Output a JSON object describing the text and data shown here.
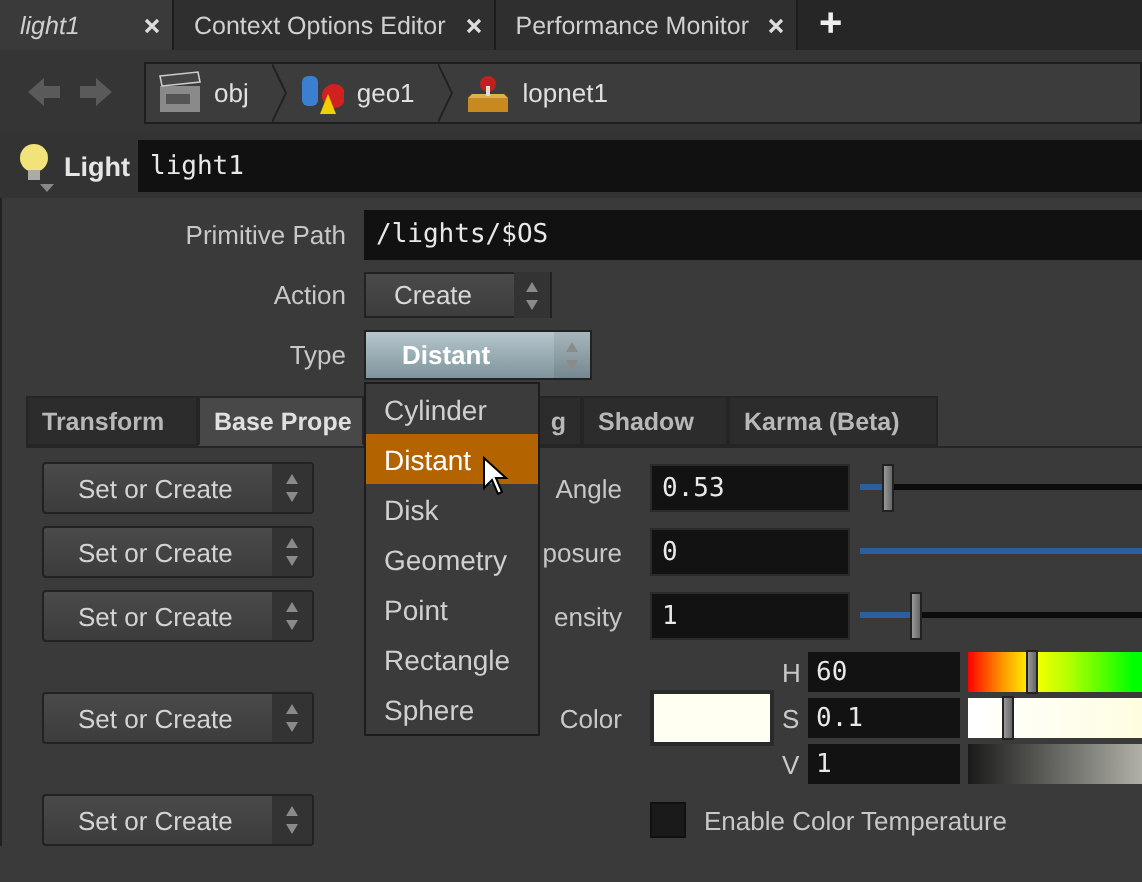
{
  "tabs": [
    {
      "label": "light1",
      "selected": true
    },
    {
      "label": "Context Options Editor",
      "selected": false
    },
    {
      "label": "Performance Monitor",
      "selected": false
    }
  ],
  "add_tab": "+",
  "path": [
    {
      "label": "obj",
      "kind": "clapper"
    },
    {
      "label": "geo1",
      "kind": "shapes"
    },
    {
      "label": "lopnet1",
      "kind": "crate"
    }
  ],
  "node": {
    "type": "Light",
    "name": "light1"
  },
  "fields": {
    "primitive_path": {
      "label": "Primitive Path",
      "value": "/lights/$OS"
    },
    "action": {
      "label": "Action",
      "value": "Create"
    },
    "type": {
      "label": "Type",
      "value": "Distant"
    }
  },
  "type_menu": [
    {
      "label": "Cylinder",
      "selected": false
    },
    {
      "label": "Distant",
      "selected": true
    },
    {
      "label": "Disk",
      "selected": false
    },
    {
      "label": "Geometry",
      "selected": false
    },
    {
      "label": "Point",
      "selected": false
    },
    {
      "label": "Rectangle",
      "selected": false
    },
    {
      "label": "Sphere",
      "selected": false
    }
  ],
  "param_tabs": [
    {
      "label": "Transform",
      "selected": false
    },
    {
      "label": "Base Prope",
      "selected": true
    },
    {
      "label": "g",
      "selected": false
    },
    {
      "label": "Shadow",
      "selected": false
    },
    {
      "label": "Karma (Beta)",
      "selected": false
    }
  ],
  "params": [
    {
      "kind": "slider",
      "control": "Set or Create",
      "label": "Angle",
      "value": "0.53",
      "level": 0.1
    },
    {
      "kind": "slider",
      "control": "Set or Create",
      "label": "posure",
      "value": "0",
      "level": 1
    },
    {
      "kind": "slider",
      "control": "Set or Create",
      "label": "ensity",
      "value": "1",
      "level": 0.2
    },
    {
      "kind": "color",
      "control": "Set or Create",
      "label": "Color",
      "color": "#fffff2",
      "channels": [
        {
          "kind": "hue",
          "label": "H",
          "value": "60",
          "level": 0.37
        },
        {
          "kind": "saturation",
          "label": "S",
          "value": "0.1",
          "level": 0.23
        },
        {
          "kind": "value",
          "label": "V",
          "value": "1"
        }
      ]
    },
    {
      "kind": "toggle",
      "control": "Set or Create",
      "label": "Enable Color Temperature",
      "checked": false
    }
  ]
}
